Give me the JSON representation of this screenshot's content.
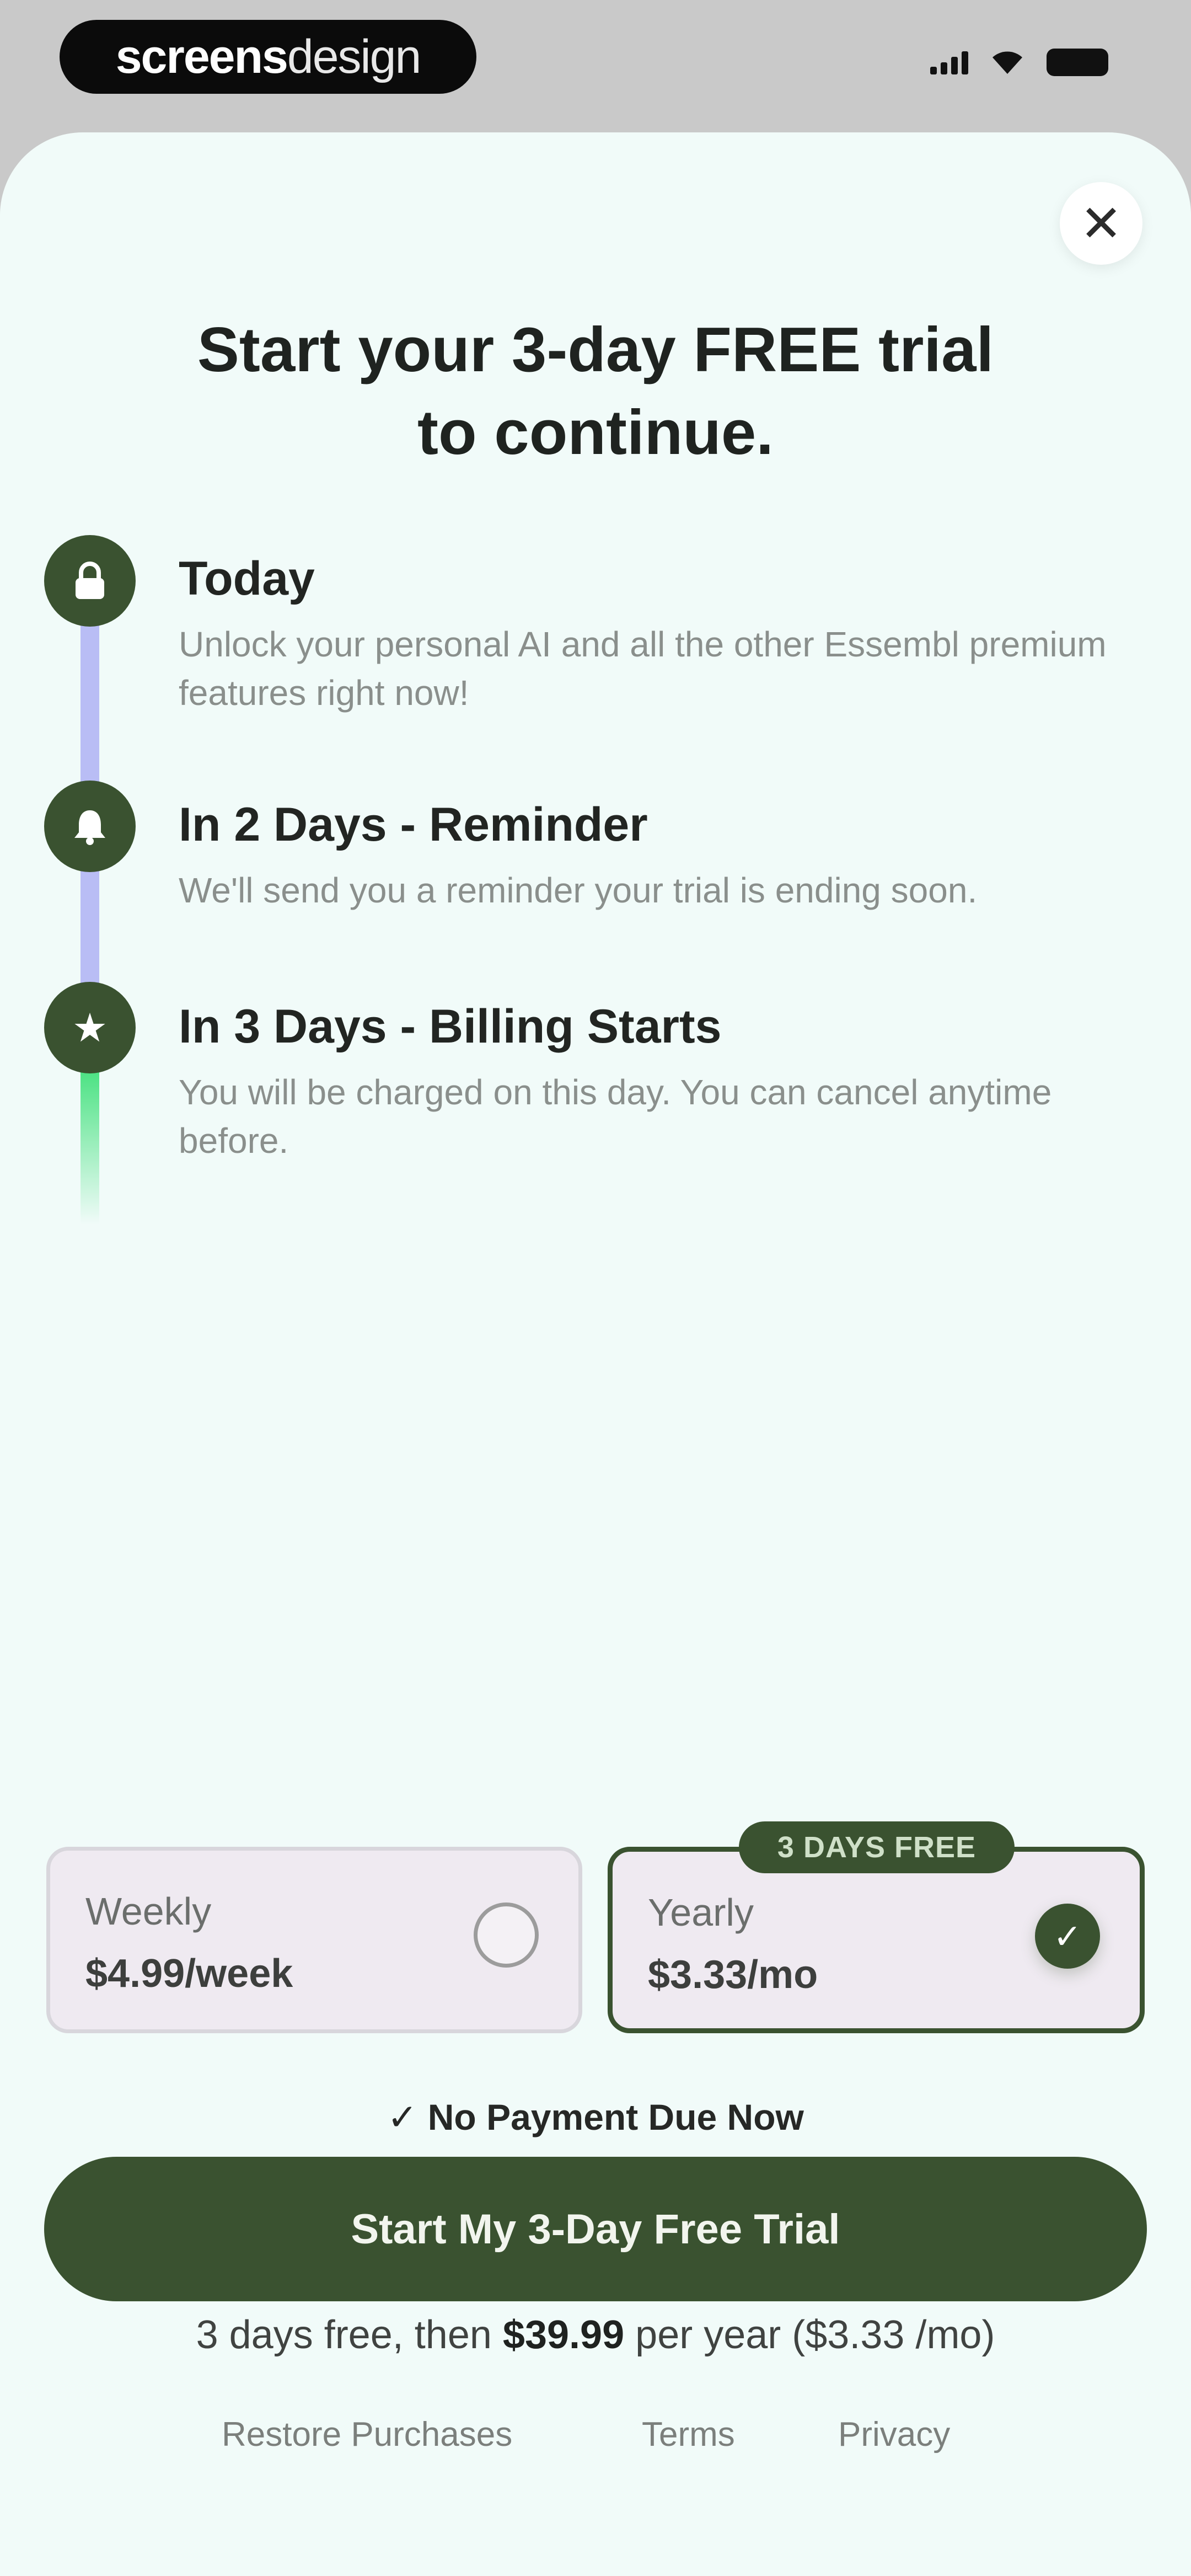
{
  "status_bar": {
    "brand_bold": "screens",
    "brand_light": "design"
  },
  "paywall": {
    "close_glyph": "✕",
    "headline_line1": "Start your 3-day FREE trial",
    "headline_line2": "to continue."
  },
  "timeline": {
    "steps": [
      {
        "icon": "lock-icon",
        "glyph": "🔒",
        "title": "Today",
        "description": "Unlock your personal AI and all the other Essembl premium features right now!"
      },
      {
        "icon": "bell-icon",
        "glyph": "🔔",
        "title": "In 2 Days - Reminder",
        "description": "We'll send you a reminder your trial is ending soon."
      },
      {
        "icon": "star-icon",
        "glyph": "★",
        "title": "In 3 Days - Billing Starts",
        "description": "You will be charged on this day. You can cancel anytime before."
      }
    ]
  },
  "plans": {
    "weekly": {
      "name": "Weekly",
      "price": "$4.99/week",
      "selected": false
    },
    "yearly": {
      "name": "Yearly",
      "price": "$3.33/mo",
      "badge": "3 DAYS FREE",
      "selected": true,
      "check_glyph": "✓"
    }
  },
  "checkout": {
    "no_payment": "✓ No Payment Due Now",
    "cta_label": "Start My 3-Day Free Trial",
    "fine_print_prefix": "3 days free, then ",
    "fine_print_price": "$39.99",
    "fine_print_suffix": " per year ($3.33 /mo)"
  },
  "footer": {
    "restore": "Restore Purchases",
    "terms": "Terms",
    "privacy": "Privacy"
  },
  "colors": {
    "brand_green": "#3a5230",
    "sheet_background": "#f1fbf9",
    "rail_lavender": "#b9bdf5",
    "rail_green": "#3fe07a"
  }
}
